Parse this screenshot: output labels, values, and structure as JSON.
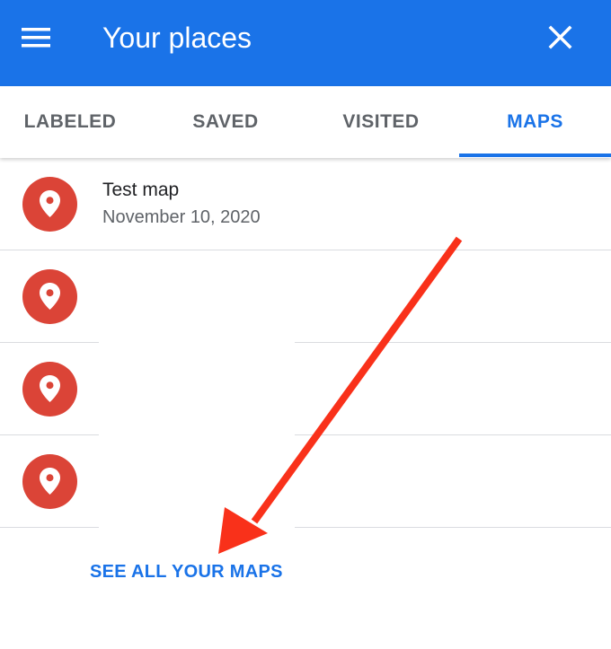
{
  "header": {
    "title": "Your places",
    "menu_icon": "menu-icon",
    "close_icon": "close-icon",
    "color": "#1a73e8"
  },
  "tabs": [
    {
      "label": "LABELED",
      "active": false
    },
    {
      "label": "SAVED",
      "active": false
    },
    {
      "label": "VISITED",
      "active": false
    },
    {
      "label": "MAPS",
      "active": true
    }
  ],
  "maps_list": {
    "items": [
      {
        "title": "Test map",
        "date": "November 10, 2020",
        "icon": "map-pin-icon"
      },
      {
        "title": "",
        "date": "",
        "icon": "map-pin-icon"
      },
      {
        "title": "",
        "date": "",
        "icon": "map-pin-icon"
      },
      {
        "title": "",
        "date": "",
        "icon": "map-pin-icon"
      }
    ],
    "pin_color": "#db4437"
  },
  "see_all_label": "SEE ALL YOUR MAPS",
  "annotation": {
    "arrow_color": "#f9311a"
  }
}
